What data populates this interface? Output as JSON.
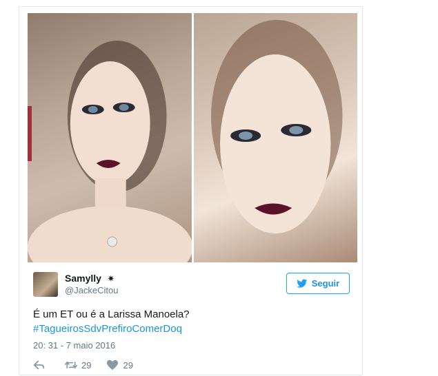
{
  "tweet": {
    "author": {
      "display_name": "Samylly",
      "badge_icon": "sparkle-icon",
      "badge_glyph": "✷",
      "handle": "@JackeCitou"
    },
    "follow_label": "Seguir",
    "text": "É um ET ou é a Larissa Manoela?",
    "hashtag": "#TagueirosSdvPrefiroComerDoq",
    "timestamp": "20: 31 - 7 maio 2016",
    "retweets": "29",
    "likes": "29"
  },
  "colors": {
    "accent": "#1b95e0",
    "muted": "#657786",
    "border": "#e1e8ed"
  },
  "icons": [
    "reply-icon",
    "retweet-icon",
    "heart-icon",
    "twitter-bird-icon"
  ]
}
